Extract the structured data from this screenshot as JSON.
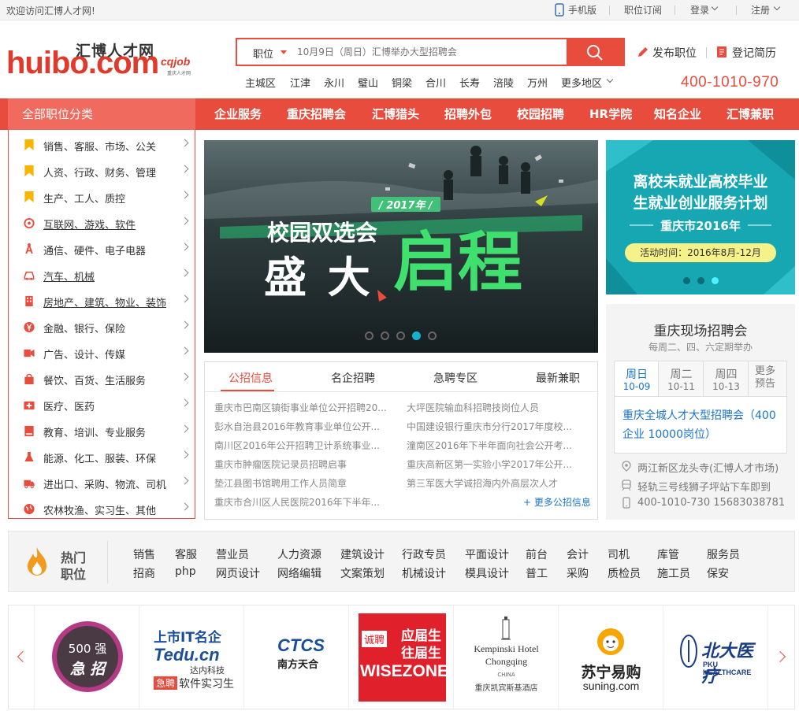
{
  "topbar": {
    "welcome": "欢迎访问汇博人才网!",
    "mobile": "手机版",
    "subscribe": "职位订阅",
    "login": "登录",
    "register": "注册"
  },
  "logo": {
    "cn": "汇博人才网",
    "en": "huibo.com",
    "sub": "cqjob",
    "sub_cn": "重庆人才网"
  },
  "search": {
    "type": "职位",
    "placeholder": "10月9日（周日）汇博举办大型招聘会"
  },
  "actions": {
    "post_job": "发布职位",
    "register_resume": "登记简历"
  },
  "areas": [
    "主城区",
    "江津",
    "永川",
    "璧山",
    "铜梁",
    "合川",
    "长寿",
    "涪陵",
    "万州",
    "更多地区"
  ],
  "hotline": "400-1010-970",
  "nav": {
    "all_categories": "全部职位分类",
    "items": [
      "企业服务",
      "重庆招聘会",
      "汇博猎头",
      "招聘外包",
      "校园招聘",
      "HR学院",
      "知名企业",
      "汇博兼职"
    ]
  },
  "categories": [
    {
      "label": "销售、客服、市场、公关",
      "icon": "bookmark-icon"
    },
    {
      "label": "人资、行政、财务、管理",
      "icon": "bookmark-icon"
    },
    {
      "label": "生产、工人、质控",
      "icon": "bookmark-icon"
    },
    {
      "label": "互联网、游戏、软件",
      "icon": "at-icon"
    },
    {
      "label": "通信、硬件、电子电器",
      "icon": "tower-icon"
    },
    {
      "label": "汽车、机械",
      "icon": "car-icon"
    },
    {
      "label": "房地产、建筑、物业、装饰",
      "icon": "building-icon"
    },
    {
      "label": "金融、银行、保险",
      "icon": "yen-icon"
    },
    {
      "label": "广告、设计、传媒",
      "icon": "video-icon"
    },
    {
      "label": "餐饮、百货、生活服务",
      "icon": "shopping-bag-icon"
    },
    {
      "label": "医疗、医药",
      "icon": "medical-kit-icon"
    },
    {
      "label": "教育、培训、专业服务",
      "icon": "book-icon"
    },
    {
      "label": "能源、化工、服装、环保",
      "icon": "flask-icon"
    },
    {
      "label": "进出口、采购、物流、司机",
      "icon": "truck-icon"
    },
    {
      "label": "农林牧渔、实习生、其他",
      "icon": "globe-icon"
    }
  ],
  "banner": {
    "year": "/ 2017年 /",
    "title1": "校园双选会",
    "title2": "盛 大",
    "title3": "启程",
    "active_dot": 4
  },
  "right_banner": {
    "line1": "离校未就业高校毕业",
    "line2": "生就业创业服务计划",
    "city": "重庆市2016年",
    "period": "活动时间：2016年8月-12月",
    "active_dot": 3
  },
  "news": {
    "tabs": [
      "公招信息",
      "名企招聘",
      "急聘专区",
      "最新兼职"
    ],
    "left": [
      "重庆市巴南区镇街事业单位公开招聘20...",
      "彭水自治县2016年教育事业单位公开...",
      "南川区2016年公开招聘卫计系统事业...",
      "重庆市肿瘤医院记录员招聘启事",
      "垫江县图书馆聘用工作人员简章",
      "重庆市合川区人民医院2016年下半年..."
    ],
    "right": [
      "大坪医院输血科招聘技岗位人员",
      "中国建设银行重庆市分行2017年度校...",
      "潼南区2016年下半年面向社会公开考...",
      "重庆高新区第一实验小学2017年公开...",
      "第三军医大学诚招海内外高层次人才"
    ],
    "more": "+ 更多公招信息"
  },
  "fair": {
    "title": "重庆现场招聘会",
    "subtitle": "每周二、四、六定期举办",
    "days": [
      {
        "day": "周日",
        "date": "10-09"
      },
      {
        "day": "周二",
        "date": "10-11"
      },
      {
        "day": "周四",
        "date": "10-13"
      }
    ],
    "more": "更多预告",
    "event": "重庆全城人才大型招聘会（400企业 10000岗位）",
    "address": "两江新区龙头寺(汇博人才市场)",
    "transit": "轻轨三号线狮子坪站下车即到",
    "phone": "400-1010-730 15683038781"
  },
  "hot": {
    "label1": "热门",
    "label2": "职位",
    "row1": [
      "销售",
      "客服",
      "营业员",
      "人力资源",
      "建筑设计",
      "行政专员",
      "平面设计",
      "前台",
      "会计",
      "司机",
      "库管",
      "服务员"
    ],
    "row2": [
      "招商",
      "php",
      "网页设计",
      "网络编辑",
      "文案策划",
      "机械设计",
      "模具设计",
      "普工",
      "采购",
      "质检员",
      "施工员",
      "保安"
    ]
  },
  "partners": {
    "p1": {
      "top": "500 强",
      "bottom": "急 招"
    },
    "p2": {
      "top": "上市IT名企",
      "brand": "Tedu.cn",
      "sub": "达内科技",
      "tag": "急聘",
      "tagtext": "软件实习生"
    },
    "p3": {
      "brand": "CTCS",
      "sub": "南方天合"
    },
    "p4": {
      "tag": "诚聘",
      "line1": "应届生",
      "line2": "往届生",
      "brand": "WISEZONE"
    },
    "p5": {
      "line1": "Kempinski Hotel",
      "line2": "Chongqing",
      "line3": "CHINA",
      "cn": "重庆凯宾斯基酒店"
    },
    "p6": {
      "cn": "苏宁易购",
      "en": "suning.com"
    },
    "p7": {
      "cn": "北大医疗",
      "en": "PKU HEALTHCARE"
    }
  }
}
